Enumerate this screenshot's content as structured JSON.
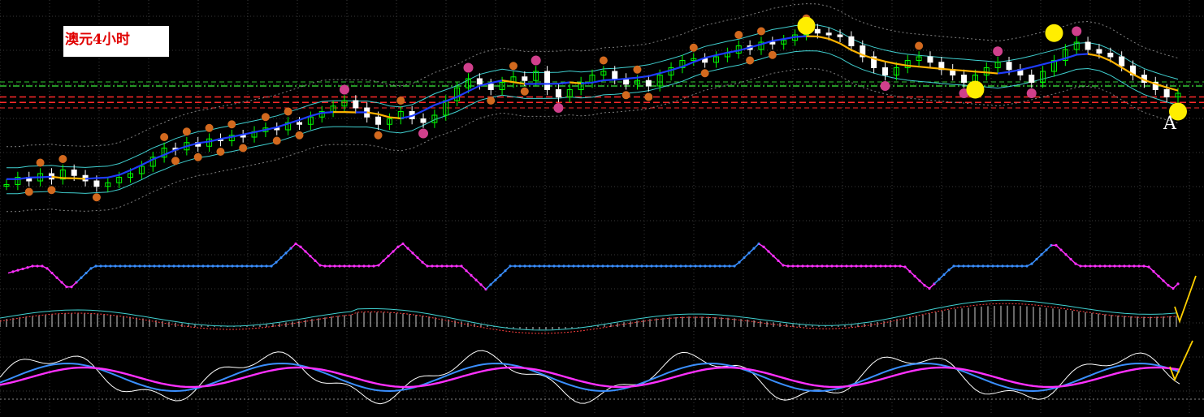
{
  "chart_title": "澳元4小时",
  "annotation_letter": "A",
  "colors": {
    "background": "#000000",
    "grid": "#3a3a3a",
    "bull_candle": "#00ff00",
    "bear_candle": "#ffffff",
    "ma_up": "#1e3cff",
    "ma_down": "#ffb400",
    "envelope": "#40d0d0",
    "outer_band": "#808080",
    "support_green": "#32c832",
    "resistance_red": "#ff2a2a",
    "marker_orange": "#d2691e",
    "marker_pink": "#d0408c",
    "marker_yellow": "#ffee00",
    "wave_blue": "#3a8fff",
    "wave_magenta": "#ff30ff",
    "signal_line": "#40d0d0",
    "signal_dash": "#ff4040",
    "stoch_fast": "#ffffff",
    "stoch_mid": "#3a8fff",
    "stoch_slow": "#ff30ff",
    "arrow_yellow": "#ffd000"
  },
  "chart_data": {
    "type": "line",
    "instrument_label": "澳元4小时",
    "grid": true,
    "price_series": [
      0.1,
      0.14,
      0.12,
      0.16,
      0.13,
      0.18,
      0.15,
      0.12,
      0.09,
      0.11,
      0.14,
      0.16,
      0.2,
      0.25,
      0.3,
      0.29,
      0.33,
      0.31,
      0.35,
      0.34,
      0.37,
      0.36,
      0.39,
      0.41,
      0.4,
      0.44,
      0.43,
      0.47,
      0.5,
      0.53,
      0.56,
      0.52,
      0.47,
      0.43,
      0.46,
      0.5,
      0.46,
      0.44,
      0.48,
      0.56,
      0.63,
      0.68,
      0.65,
      0.62,
      0.66,
      0.69,
      0.67,
      0.72,
      0.62,
      0.58,
      0.62,
      0.66,
      0.7,
      0.72,
      0.68,
      0.65,
      0.67,
      0.64,
      0.7,
      0.74,
      0.78,
      0.79,
      0.77,
      0.8,
      0.82,
      0.86,
      0.84,
      0.88,
      0.87,
      0.89,
      0.92,
      0.95,
      0.93,
      0.92,
      0.91,
      0.86,
      0.8,
      0.74,
      0.7,
      0.74,
      0.78,
      0.8,
      0.77,
      0.73,
      0.7,
      0.66,
      0.7,
      0.74,
      0.77,
      0.73,
      0.7,
      0.66,
      0.72,
      0.78,
      0.84,
      0.88,
      0.84,
      0.82,
      0.8,
      0.75,
      0.7,
      0.66,
      0.62,
      0.58,
      0.6
    ],
    "support_level": 0.64,
    "resistance_levels": [
      0.58,
      0.55
    ]
  }
}
